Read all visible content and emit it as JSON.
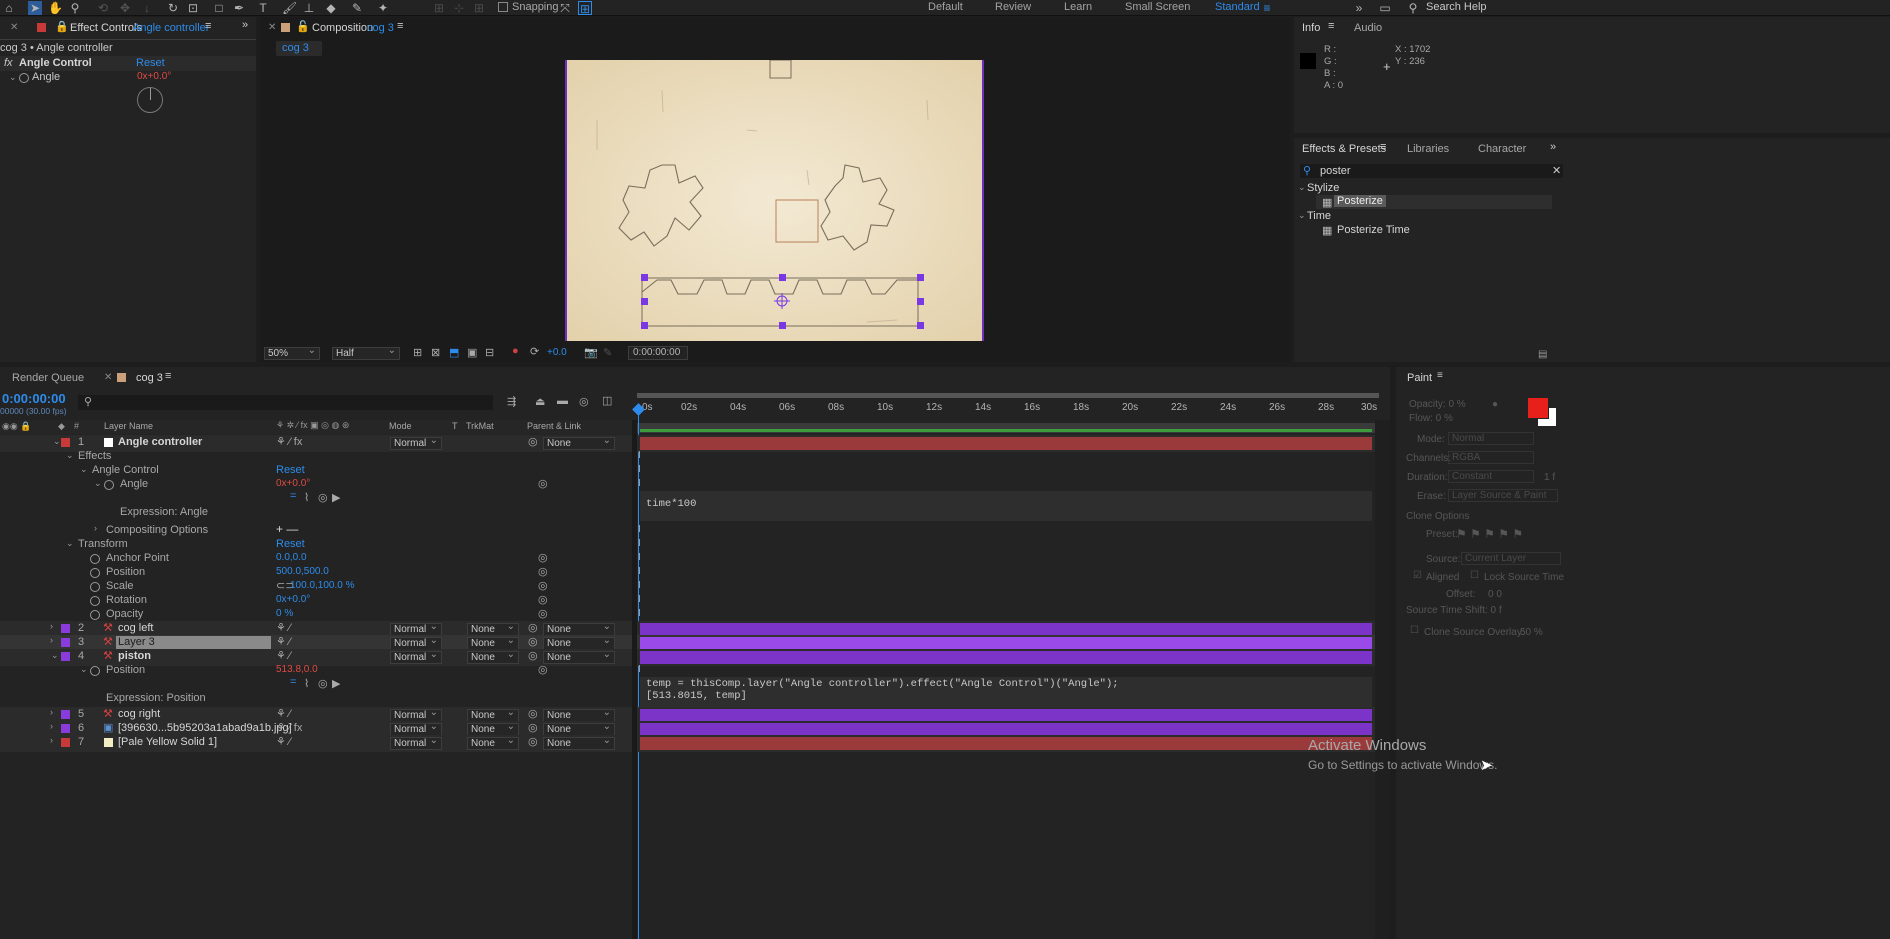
{
  "toolbar": {
    "snapping_label": "Snapping",
    "workspaces": [
      "Default",
      "Review",
      "Learn",
      "Small Screen",
      "Standard"
    ],
    "search_help": "Search Help"
  },
  "effect_controls": {
    "tab_prefix": "Effect Controls",
    "tab_layer": "Angle controller",
    "breadcrumb": "cog 3 • Angle controller",
    "fx_label": "fx",
    "effect_name": "Angle Control",
    "reset": "Reset",
    "angle_label": "Angle",
    "angle_value": "0x+0.0°"
  },
  "composition": {
    "tab_prefix": "Composition",
    "tab_comp": "cog 3",
    "crumb": "cog 3",
    "zoom": "50%",
    "resolution": "Half",
    "exposure": "+0.0",
    "timecode": "0:00:00:00"
  },
  "info": {
    "tab": "Info",
    "tab2": "Audio",
    "r": "R :",
    "g": "G :",
    "b": "B :",
    "a": "A : 0",
    "x": "X : 1702",
    "y": "Y : 236"
  },
  "effects_presets": {
    "tab": "Effects & Presets",
    "tab2": "Libraries",
    "tab3": "Character",
    "search": "poster",
    "cat1": "Stylize",
    "item1": "Posterize",
    "cat2": "Time",
    "item2": "Posterize Time"
  },
  "timeline": {
    "tab_render": "Render Queue",
    "tab_comp": "cog 3",
    "timecode": "0:00:00:00",
    "fps": "00000 (30.00 fps)",
    "headers": {
      "layer_name": "Layer Name",
      "mode": "Mode",
      "t": "T",
      "trkmat": "TrkMat",
      "parent": "Parent & Link"
    },
    "ruler": [
      "0s",
      "02s",
      "04s",
      "06s",
      "08s",
      "10s",
      "12s",
      "14s",
      "16s",
      "18s",
      "20s",
      "22s",
      "24s",
      "26s",
      "28s",
      "30s"
    ],
    "layers": [
      {
        "num": "1",
        "name": "Angle controller",
        "mode": "Normal",
        "trkmat": "",
        "parent": "None",
        "color": "#c83a3a"
      },
      {
        "num": "2",
        "name": "cog left",
        "mode": "Normal",
        "trkmat": "None",
        "parent": "None",
        "color": "#8a3bdc"
      },
      {
        "num": "3",
        "name": "Layer 3",
        "mode": "Normal",
        "trkmat": "None",
        "parent": "None",
        "color": "#8a3bdc"
      },
      {
        "num": "4",
        "name": "piston",
        "mode": "Normal",
        "trkmat": "None",
        "parent": "None",
        "color": "#8a3bdc"
      },
      {
        "num": "5",
        "name": "cog right",
        "mode": "Normal",
        "trkmat": "None",
        "parent": "None",
        "color": "#8a3bdc"
      },
      {
        "num": "6",
        "name": "[396630...5b95203a1abad9a1b.jpg]",
        "mode": "Normal",
        "trkmat": "None",
        "parent": "None",
        "color": "#8a3bdc"
      },
      {
        "num": "7",
        "name": "[Pale Yellow Solid 1]",
        "mode": "Normal",
        "trkmat": "None",
        "parent": "None",
        "color": "#c83a3a"
      }
    ],
    "props": {
      "effects": "Effects",
      "angle_control": "Angle Control",
      "reset": "Reset",
      "angle": "Angle",
      "angle_value": "0x+0.0°",
      "expression_angle": "Expression: Angle",
      "compositing": "Compositing Options",
      "compositing_value": "+ —",
      "transform": "Transform",
      "anchor": "Anchor Point",
      "anchor_value": "0.0,0.0",
      "position": "Position",
      "position_value": "500.0,500.0",
      "scale": "Scale",
      "scale_value": "100.0,100.0 %",
      "rotation": "Rotation",
      "rotation_value": "0x+0.0°",
      "opacity": "Opacity",
      "opacity_value": "0 %",
      "piston_position": "Position",
      "piston_position_value": "513.8,0.0",
      "expression_position": "Expression: Position"
    },
    "expr_angle": "time*100",
    "expr_position_1": "temp = thisComp.layer(\"Angle controller\").effect(\"Angle Control\")(\"Angle\");",
    "expr_position_2": "[513.8015, temp]"
  },
  "paint": {
    "tab": "Paint",
    "opacity": "Opacity: 0 %",
    "flow": "Flow: 0 %",
    "mode_label": "Mode:",
    "mode": "Normal",
    "channels_label": "Channels:",
    "channels": "RGBA",
    "duration_label": "Duration:",
    "duration": "Constant",
    "duration_val": "1 f",
    "erase_label": "Erase:",
    "erase": "Layer Source & Paint",
    "clone_options": "Clone Options",
    "preset": "Preset:",
    "source_label": "Source:",
    "source": "Current Layer",
    "aligned": "Aligned",
    "lock": "Lock Source Time",
    "offset": "Offset:",
    "offset_vals": "0      0",
    "shift": "Source Time Shift: 0 f",
    "overlay": "Clone Source Overlay:",
    "overlay_val": "50 %",
    "fg_color": "#e8201c",
    "bg_color": "#ffffff"
  },
  "watermark": {
    "line1": "Activate Windows",
    "line2": "Go to Settings to activate Windows."
  }
}
